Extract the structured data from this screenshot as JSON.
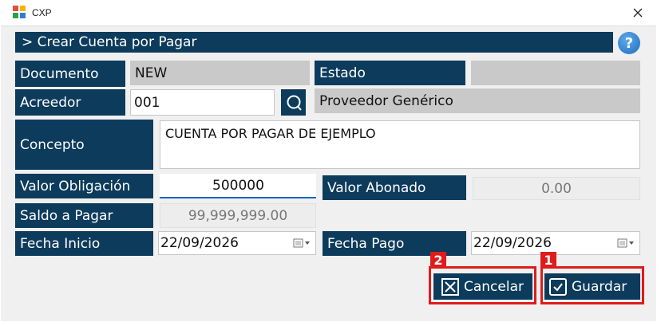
{
  "window": {
    "title": "CXP"
  },
  "header": {
    "title": "> Crear Cuenta por Pagar",
    "help": "?"
  },
  "form": {
    "documento_label": "Documento",
    "documento_value": "NEW",
    "estado_label": "Estado",
    "estado_value": "",
    "acreedor_label": "Acreedor",
    "acreedor_value": "001",
    "acreedor_name": "Proveedor Genérico",
    "concepto_label": "Concepto",
    "concepto_value": "CUENTA POR PAGAR DE EJEMPLO",
    "valor_obligacion_label": "Valor Obligación",
    "valor_obligacion_value": "500000",
    "valor_abonado_label": "Valor Abonado",
    "valor_abonado_value": "0.00",
    "saldo_label": "Saldo a Pagar",
    "saldo_value": "99,999,999.00",
    "fecha_inicio_label": "Fecha Inicio",
    "fecha_inicio_value": "22/09/2026",
    "fecha_pago_label": "Fecha Pago",
    "fecha_pago_value": "22/09/2026"
  },
  "actions": {
    "cancel_label": "Cancelar",
    "save_label": "Guardar",
    "cancel_badge": "2",
    "save_badge": "1"
  },
  "colors": {
    "label_bg": "#0d3b5c",
    "highlight": "#e01b1b",
    "accent": "#1565c0"
  }
}
